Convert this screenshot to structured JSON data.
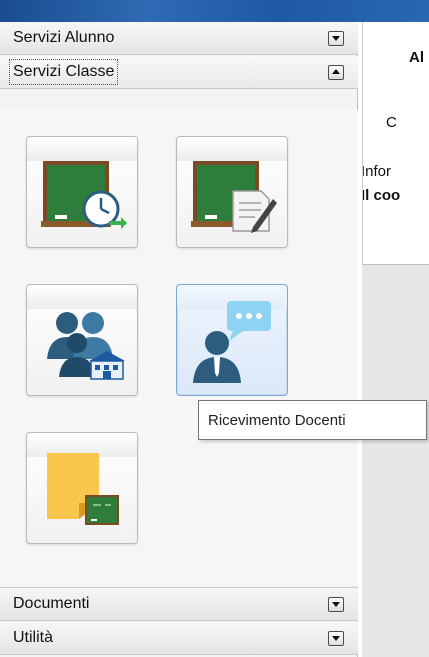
{
  "sidebar": {
    "sections": [
      {
        "label": "Servizi Alunno",
        "state": "collapsed"
      },
      {
        "label": "Servizi Classe",
        "state": "expanded"
      },
      {
        "label": "Documenti",
        "state": "collapsed"
      },
      {
        "label": "Utilità",
        "state": "collapsed"
      }
    ],
    "tiles": [
      {
        "icon": "chalkboard-clock-icon"
      },
      {
        "icon": "chalkboard-document-icon"
      },
      {
        "icon": "parents-school-icon"
      },
      {
        "icon": "teacher-speech-bubble-icon",
        "hovered": true
      },
      {
        "icon": "sticky-note-chalkboard-icon"
      }
    ]
  },
  "tooltip": {
    "text": "Ricevimento Docenti"
  },
  "content": {
    "line1": "Al",
    "line2": "C",
    "line3": "Infor",
    "line4": "Il coo"
  },
  "colors": {
    "chalkboard": "#2f7d3a",
    "frame": "#7a4a25",
    "person": "#2c5d7f",
    "bubble": "#8fd3f3",
    "sticky": "#f8c64c",
    "hover_border": "#7fa7d6"
  }
}
